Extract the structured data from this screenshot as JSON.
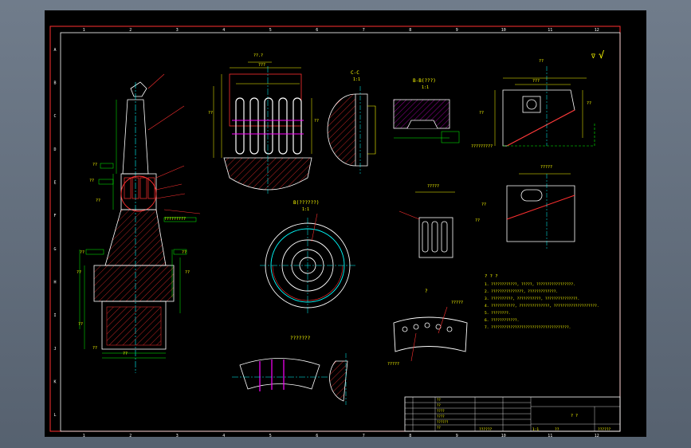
{
  "drawing": {
    "border_columns": [
      "1",
      "2",
      "3",
      "4",
      "5",
      "6",
      "7",
      "8",
      "9",
      "10",
      "11",
      "12"
    ],
    "border_rows": [
      "A",
      "B",
      "C",
      "D",
      "E",
      "F",
      "G",
      "H",
      "I",
      "J",
      "K",
      "L"
    ],
    "roughness_mark": "√",
    "roughness_prefix": "∇",
    "section_labels": {
      "c_c": "C-C",
      "c_c_scale": "1:1",
      "b_b": "B-B(???)",
      "b_b_scale": "1:1",
      "b_view": "B(??????)",
      "b_view_scale": "1:1",
      "top_dim": "??.?",
      "mid_label": "??????",
      "bottom_view_label": "???????",
      "detail_label": "?"
    },
    "notes": {
      "title": "?  ?  ?",
      "lines": [
        "1. ????????????, ?????, ?????????????????.",
        "2. ???????????????, ?????????????.",
        "3. ??????????, ???????????, ???????????????.",
        "4. ???????????, ??????????????, ????????????????????.",
        "5. ????????.",
        "6. ????????????.",
        "7. ????????????????????????????????????."
      ]
    },
    "title_block": {
      "rows": [
        "??",
        "??",
        "????",
        "????",
        "??????",
        "??"
      ],
      "name": "? ?",
      "material": "??????",
      "scale": "1:1",
      "sheet": "??",
      "number": "??????"
    }
  }
}
